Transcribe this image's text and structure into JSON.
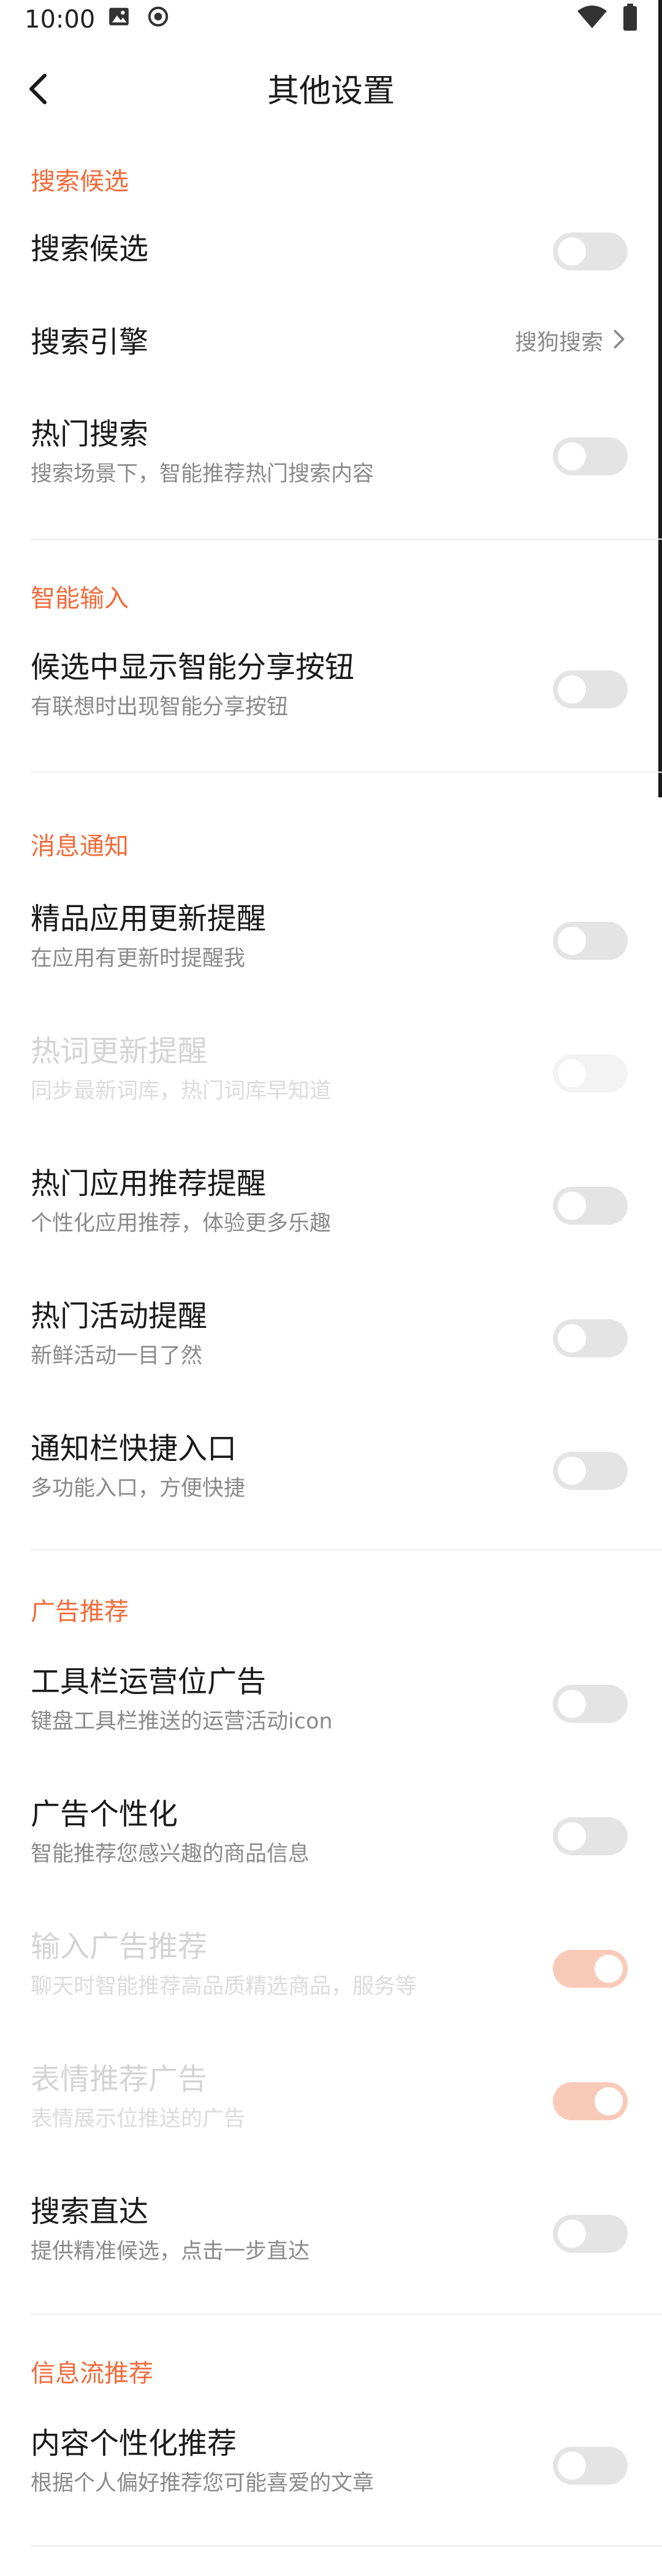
{
  "status_bar": {
    "time": "10:00",
    "icons_left": [
      "image-icon",
      "record-icon"
    ],
    "icons_right": [
      "wifi-icon",
      "battery-icon"
    ]
  },
  "header": {
    "title": "其他设置"
  },
  "sections": [
    {
      "title": "搜索候选",
      "items": [
        {
          "title": "搜索候选",
          "subtitle": "",
          "control": "toggle",
          "on": false,
          "enabled": true
        },
        {
          "title": "搜索引擎",
          "subtitle": "",
          "control": "link",
          "value": "搜狗搜索",
          "enabled": true
        },
        {
          "title": "热门搜索",
          "subtitle": "搜索场景下，智能推荐热门搜索内容",
          "control": "toggle",
          "on": false,
          "enabled": true
        }
      ]
    },
    {
      "title": "智能输入",
      "items": [
        {
          "title": "候选中显示智能分享按钮",
          "subtitle": "有联想时出现智能分享按钮",
          "control": "toggle",
          "on": false,
          "enabled": true
        }
      ]
    },
    {
      "title": "消息通知",
      "items": [
        {
          "title": "精品应用更新提醒",
          "subtitle": "在应用有更新时提醒我",
          "control": "toggle",
          "on": false,
          "enabled": true
        },
        {
          "title": "热词更新提醒",
          "subtitle": "同步最新词库，热门词库早知道",
          "control": "toggle",
          "on": false,
          "enabled": false
        },
        {
          "title": "热门应用推荐提醒",
          "subtitle": "个性化应用推荐，体验更多乐趣",
          "control": "toggle",
          "on": false,
          "enabled": true
        },
        {
          "title": "热门活动提醒",
          "subtitle": "新鲜活动一目了然",
          "control": "toggle",
          "on": false,
          "enabled": true
        },
        {
          "title": "通知栏快捷入口",
          "subtitle": "多功能入口，方便快捷",
          "control": "toggle",
          "on": false,
          "enabled": true
        }
      ]
    },
    {
      "title": "广告推荐",
      "items": [
        {
          "title": "工具栏运营位广告",
          "subtitle": "键盘工具栏推送的运营活动icon",
          "control": "toggle",
          "on": false,
          "enabled": true
        },
        {
          "title": "广告个性化",
          "subtitle": "智能推荐您感兴趣的商品信息",
          "control": "toggle",
          "on": false,
          "enabled": true
        },
        {
          "title": "输入广告推荐",
          "subtitle": "聊天时智能推荐高品质精选商品，服务等",
          "control": "toggle",
          "on": true,
          "enabled": false
        },
        {
          "title": "表情推荐广告",
          "subtitle": "表情展示位推送的广告",
          "control": "toggle",
          "on": true,
          "enabled": false
        },
        {
          "title": "搜索直达",
          "subtitle": "提供精准候选，点击一步直达",
          "control": "toggle",
          "on": false,
          "enabled": true
        }
      ]
    },
    {
      "title": "信息流推荐",
      "items": [
        {
          "title": "内容个性化推荐",
          "subtitle": "根据个人偏好推荐您可能喜爱的文章",
          "control": "toggle",
          "on": false,
          "enabled": true
        }
      ]
    }
  ],
  "colors": {
    "accent": "#f26b3a",
    "toggle_off": "#e4e4e4",
    "subtitle": "#8a8a8a",
    "disabled_text": "#d4d4d4"
  }
}
